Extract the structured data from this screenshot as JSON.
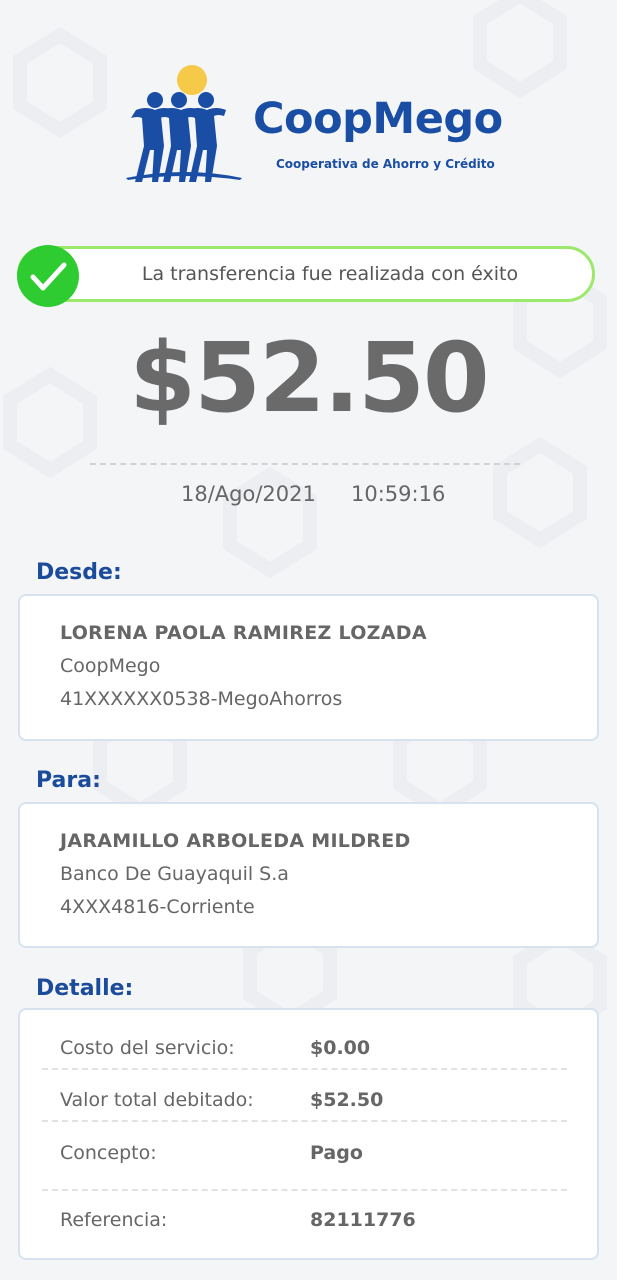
{
  "logo": {
    "name": "CoopMego",
    "subtitle": "Cooperativa de Ahorro y Crédito"
  },
  "status": {
    "message": "La transferencia fue realizada con éxito",
    "icon": "check-icon",
    "color": "#2ecc30"
  },
  "transaction": {
    "amount": "$52.50",
    "date": "18/Ago/2021",
    "time": "10:59:16"
  },
  "from": {
    "label": "Desde:",
    "name": "LORENA PAOLA RAMIREZ LOZADA",
    "bank": "CoopMego",
    "account": "41XXXXXX0538-MegoAhorros"
  },
  "to": {
    "label": "Para:",
    "name": "JARAMILLO ARBOLEDA MILDRED",
    "bank": "Banco De Guayaquil S.a",
    "account": "4XXX4816-Corriente"
  },
  "details": {
    "label": "Detalle:",
    "rows": [
      {
        "label": "Costo del servicio:",
        "value": "$0.00"
      },
      {
        "label": "Valor total debitado:",
        "value": "$52.50"
      },
      {
        "label": "Concepto:",
        "value": "Pago"
      },
      {
        "label": "Referencia:",
        "value": "82111776"
      }
    ]
  },
  "colors": {
    "brand": "#1a4ea5",
    "accent_yellow": "#f7c948",
    "success_border": "#9be96a",
    "section_label": "#1b4c9c"
  }
}
